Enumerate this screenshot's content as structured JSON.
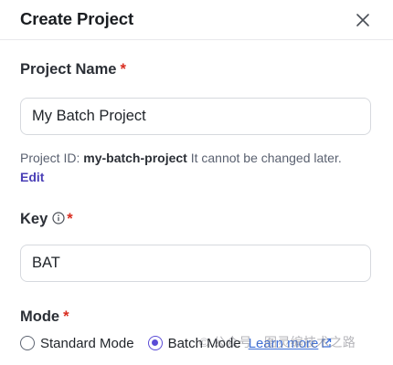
{
  "dialog": {
    "title": "Create Project",
    "close_icon": "close-icon"
  },
  "project_name": {
    "label": "Project Name",
    "required_mark": "*",
    "value": "My Batch Project"
  },
  "project_id": {
    "prefix": "Project ID:",
    "id": "my-batch-project",
    "suffix": "It cannot be changed later.",
    "edit_label": "Edit"
  },
  "key": {
    "label": "Key",
    "info_icon": "info-icon",
    "required_mark": "*",
    "value": "BAT"
  },
  "mode": {
    "label": "Mode",
    "required_mark": "*",
    "options": [
      {
        "label": "Standard Mode",
        "selected": false
      },
      {
        "label": "Batch Mode",
        "selected": true
      }
    ],
    "learn_more_label": "Learn more",
    "external_link_icon": "external-link-icon"
  },
  "watermark": "© 公众号 · 图灵编技术之路",
  "colors": {
    "accent": "#5b4cd6",
    "required": "#d92d20",
    "link": "#4a3fb6"
  }
}
